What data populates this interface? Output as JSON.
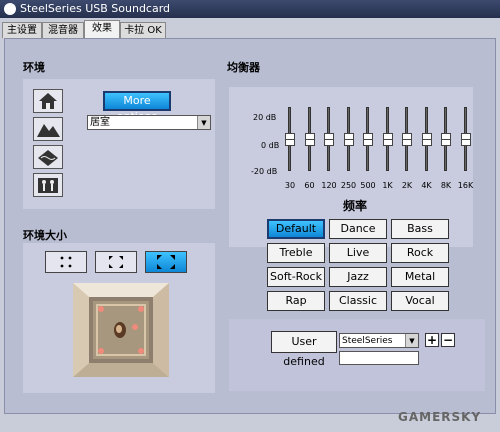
{
  "window": {
    "title": "SteelSeries USB Soundcard"
  },
  "tabs": [
    {
      "label": "主设置"
    },
    {
      "label": "混音器"
    },
    {
      "label": "效果"
    },
    {
      "label": "卡拉 OK"
    }
  ],
  "environment": {
    "heading": "环境",
    "more_options": "More options",
    "selected": "居室",
    "env_icons": [
      "house-icon",
      "mountains-icon",
      "waves-icon",
      "people-icon"
    ]
  },
  "environment_size": {
    "heading": "环境大小"
  },
  "equalizer": {
    "heading": "均衡器",
    "db_labels": [
      "20 dB",
      "0 dB",
      "-20 dB"
    ],
    "bands": [
      "30",
      "60",
      "120",
      "250",
      "500",
      "1K",
      "2K",
      "4K",
      "8K",
      "16K"
    ],
    "band_levels_db": [
      0,
      0,
      0,
      0,
      0,
      0,
      0,
      0,
      0,
      0
    ],
    "axis_label": "频率",
    "presets": [
      "Default",
      "Dance",
      "Bass",
      "Treble",
      "Live",
      "Rock",
      "Soft-Rock",
      "Jazz",
      "Metal",
      "Rap",
      "Classic",
      "Vocal"
    ],
    "active_preset": "Default",
    "user_defined_label": "User defined",
    "user_select": "SteelSeries",
    "user_name_value": ""
  },
  "watermark": "GAMERSKY",
  "colors": {
    "accent": "#1ea3ef",
    "panel": "#b9bdd2"
  }
}
